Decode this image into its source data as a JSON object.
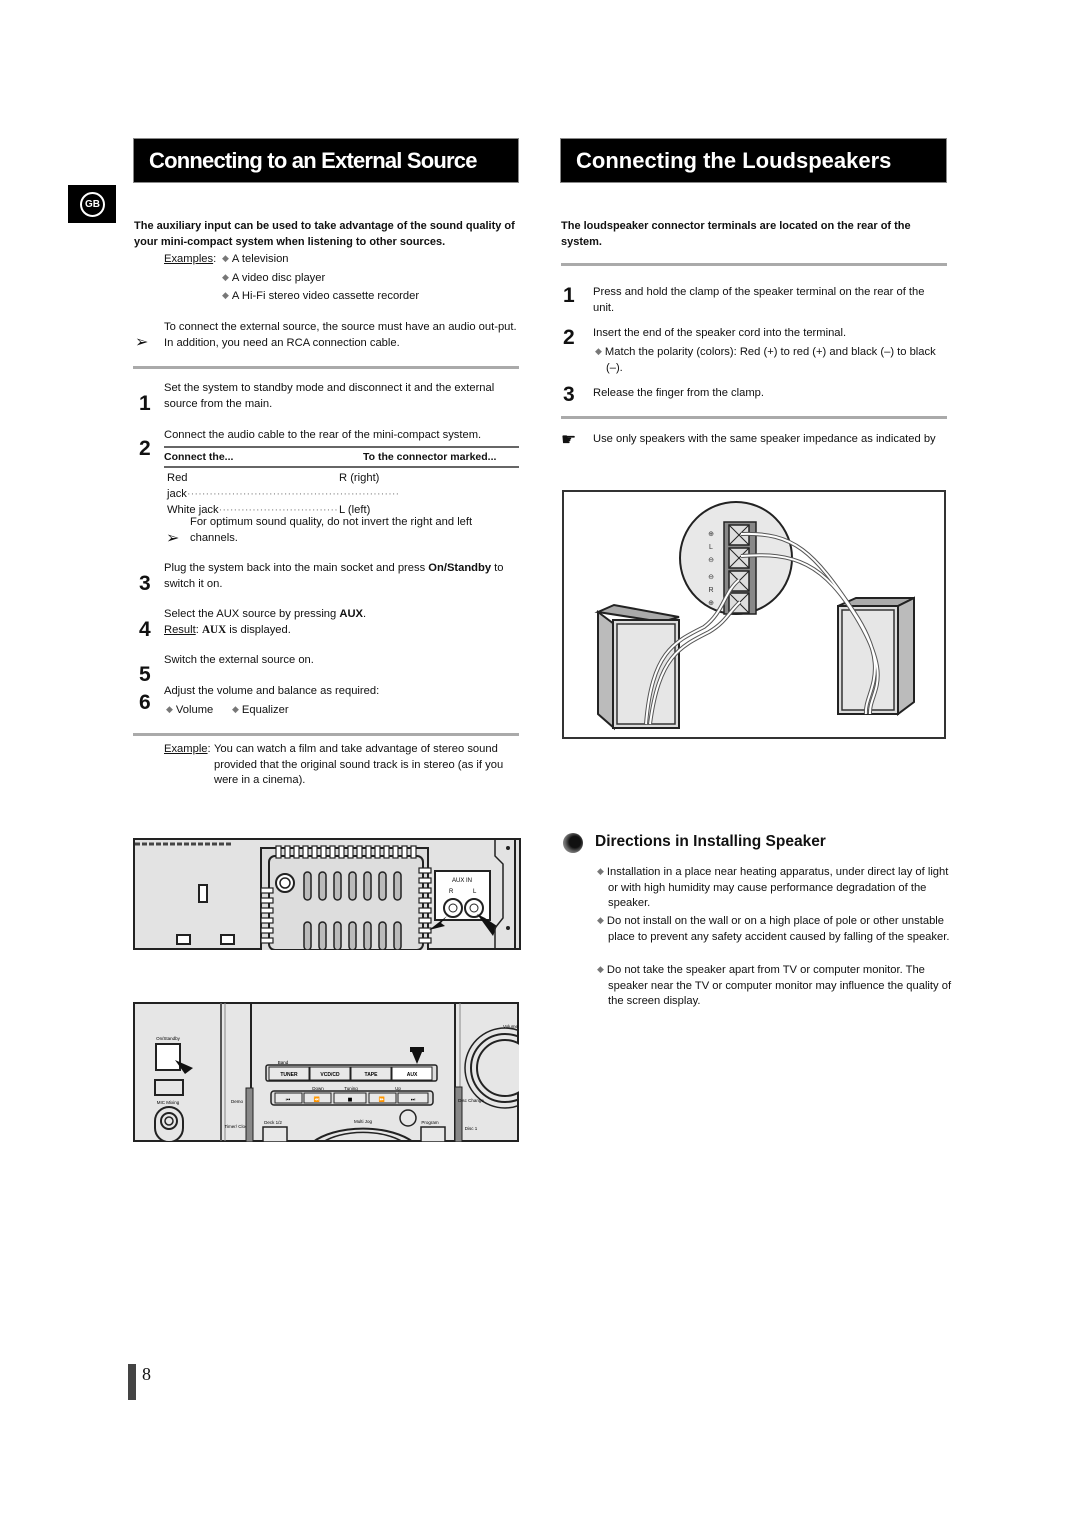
{
  "language_badge": "GB",
  "left": {
    "title": "Connecting to an External Source",
    "intro": "The auxiliary input can be used to take advantage of the sound quality of your mini-compact system when listening to other sources.",
    "examples_label": "Examples",
    "examples": [
      "A television",
      "A video disc player",
      "A Hi-Fi stereo video cassette recorder"
    ],
    "note_1": "To connect the external source, the source must have an audio out-put. In addition, you need an RCA connection cable.",
    "steps": [
      {
        "num": "1",
        "text": "Set the system to standby mode and disconnect it and the external source from the main."
      },
      {
        "num": "2",
        "text": "Connect the audio cable to the rear of the mini-compact system."
      },
      {
        "num": "3",
        "text_a": "Plug the system back into the main socket and press ",
        "bold": "On/Standby",
        "text_b": " to switch it on."
      },
      {
        "num": "4",
        "text_a": "Select the AUX source by pressing ",
        "bold": "AUX",
        "text_b": ".",
        "result_label": "Result",
        "result_bold": "AUX",
        "result_text": " is displayed."
      },
      {
        "num": "5",
        "text": "Switch the external source on."
      },
      {
        "num": "6",
        "text": "Adjust the volume and balance as required:",
        "options": [
          "Volume",
          "Equalizer"
        ]
      }
    ],
    "table": {
      "headers": [
        "Connect the...",
        "To the connector marked..."
      ],
      "rows": [
        {
          "jack": "Red jack",
          "connector": "R (right)"
        },
        {
          "jack": "White jack",
          "connector": "L (left)"
        }
      ]
    },
    "note_2": "For optimum sound quality, do not invert the right and left channels.",
    "example_label": "Example",
    "example_text": "You can watch a film and take advantage of stereo sound provided that the original sound track is in stereo (as if you were in a cinema).",
    "rear_panel": {
      "aux_in": "AUX IN",
      "r": "R",
      "l": "L"
    },
    "front_panel": {
      "on_standby": "On/Standby",
      "mic_mixing": "MIC Mixing",
      "demo": "Demo",
      "timer_clock": "Timer/ Clock",
      "deck": "Deck 1/2",
      "band": "Band",
      "buttons": [
        "TUNER",
        "VCD/CD",
        "TAPE",
        "AUX"
      ],
      "down": "Down",
      "tuning": "Tuning",
      "up": "Up",
      "transport": [
        "⏮",
        "⏪",
        "■",
        "⏩",
        "⏭"
      ],
      "multi_jog": "Multi Jog",
      "program": "Program",
      "volume": "Volume",
      "disc_change": "Disc Change",
      "disc1": "Disc 1"
    }
  },
  "right": {
    "title": "Connecting the Loudspeakers",
    "intro": "The loudspeaker connector terminals are located on the rear of the system.",
    "steps": [
      {
        "num": "1",
        "text": "Press and hold the clamp of the speaker terminal on the rear of the unit."
      },
      {
        "num": "2",
        "text": "Insert the end of the speaker cord into the terminal.",
        "sub": "Match the polarity (colors): Red (+) to red (+) and black (–) to black (–)."
      },
      {
        "num": "3",
        "text": "Release the finger from the clamp."
      }
    ],
    "note": "Use only speakers with the same speaker impedance as indicated by",
    "terminal_labels": {
      "l": "L",
      "r": "R"
    },
    "directions": {
      "title": "Directions in Installing Speaker",
      "items": [
        "Installation in a place near heating apparatus, under direct lay of light or with high humidity may cause performance degradation of the speaker.",
        "Do not install on the wall or on a high place of pole or other unstable place to prevent any safety accident caused by falling of the speaker.",
        "Do not take the speaker apart from TV or computer monitor. The speaker near the TV or computer monitor may influence the quality of the screen display."
      ]
    }
  },
  "page_number": "8"
}
